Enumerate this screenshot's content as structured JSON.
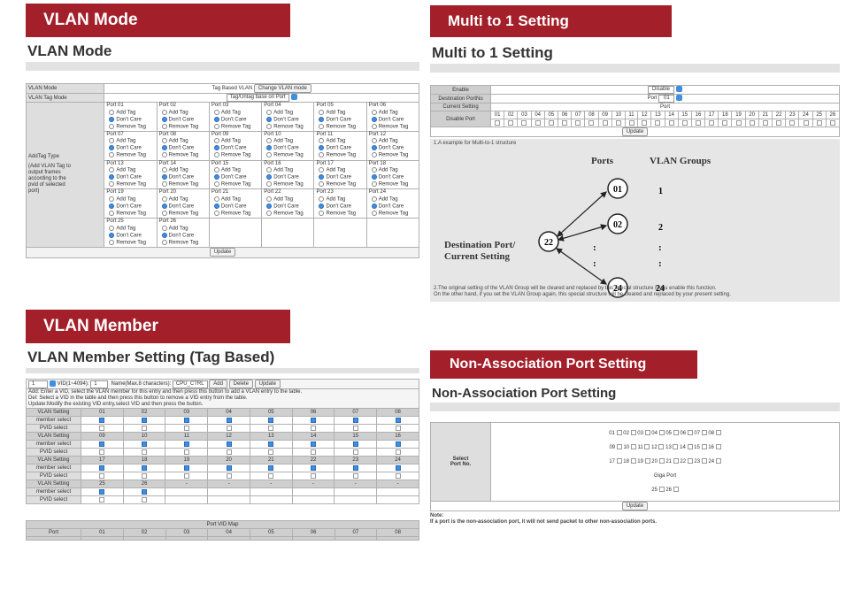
{
  "ribbons": {
    "vlan_mode": "VLAN Mode",
    "multi_to_1": "Multi to 1 Setting",
    "vlan_member": "VLAN Member",
    "non_assoc": "Non-Association Port Setting"
  },
  "vlan_mode": {
    "title": "VLAN Mode",
    "mode_label": "VLAN Mode",
    "mode_value": "Tag Based VLAN",
    "change_button": "Change VLAN mode",
    "tag_mode_label": "VLAN Tag Mode",
    "tag_mode_value": "Tag/Untag base on Port",
    "add_tag_type_label": "AddTag Type",
    "add_tag_type_help": "(Add VLAN Tag to output frames according to the pvid of selected port)",
    "option_add": "Add Tag",
    "option_dont": "Don't Care",
    "option_remove": "Remove Tag",
    "ports": [
      "Port 01",
      "Port 02",
      "Port 03",
      "Port 04",
      "Port 05",
      "Port 06",
      "Port 07",
      "Port 08",
      "Port 09",
      "Port 10",
      "Port 11",
      "Port 12",
      "Port 13",
      "Port 14",
      "Port 15",
      "Port 16",
      "Port 17",
      "Port 18",
      "Port 19",
      "Port 20",
      "Port 21",
      "Port 22",
      "Port 23",
      "Port 24",
      "Port 25",
      "Port 26"
    ],
    "update_button": "Update"
  },
  "multi": {
    "title": "Multi to 1 Setting",
    "enable_label": "Enable",
    "enable_value": "Disable",
    "dest_label": "Destination PortNo",
    "dest_prefix": "Port",
    "dest_value": "01",
    "current_label": "Current Setting",
    "disable_label": "Disable Port",
    "port_header": "Port",
    "ports": [
      "01",
      "02",
      "03",
      "04",
      "05",
      "06",
      "07",
      "08",
      "09",
      "10",
      "11",
      "12",
      "13",
      "14",
      "15",
      "16",
      "17",
      "18",
      "19",
      "20",
      "21",
      "22",
      "23",
      "24",
      "25",
      "26"
    ],
    "update_button": "Update",
    "note1": "1.A example for Multi-to-1 structure",
    "diagram": {
      "ports_head": "Ports",
      "groups_head": "VLAN Groups",
      "dest_line1": "Destination Port/",
      "dest_line2": "Current Setting",
      "dest_node": "22",
      "nodes": [
        "01",
        "02",
        "24"
      ],
      "groups": [
        "1",
        "2",
        "24"
      ],
      "dots": ":"
    },
    "note2": "2.The original setting of the VLAN Group will be cleared and replaced by this special structure if you enable this function.",
    "note3": "On the other hand, if you set the VLAN Group again, this special structure will be cleared and replaced by your present setting."
  },
  "member": {
    "title": "VLAN Member Setting (Tag Based)",
    "vid_value": "1",
    "vid_label": "VID(1~4094):",
    "vid_input": "1",
    "name_label": "Name(Max.8 characters):",
    "name_value": "CPU_CTRL",
    "add_button": "Add",
    "delete_button": "Delete",
    "update_button": "Update",
    "help1": "Add: Enter a VID, select the VLAN member for this entry and then press this button to add a VLAN entry to the table.",
    "help2": "Del: Select a VID in the table and then press this button to remove a VID entry from the table.",
    "help3": "Update:Modify the existing VID entry,select VID and then press the button.",
    "row_setting": "VLAN Setting",
    "row_member": "member select",
    "row_pvid": "PVID select",
    "groups": [
      [
        "01",
        "02",
        "03",
        "04",
        "05",
        "06",
        "07",
        "08"
      ],
      [
        "09",
        "10",
        "11",
        "12",
        "13",
        "14",
        "15",
        "16"
      ],
      [
        "17",
        "18",
        "19",
        "20",
        "21",
        "22",
        "23",
        "24"
      ],
      [
        "25",
        "26",
        "-",
        "-",
        "-",
        "-",
        "-",
        "-"
      ]
    ],
    "pvid_map_title": "Port VID Map",
    "pvid_port_label": "Port",
    "pvid_ports": [
      "01",
      "02",
      "03",
      "04",
      "05",
      "06",
      "07",
      "08"
    ]
  },
  "nonassoc": {
    "title": "Non-Association Port Setting",
    "select_label1": "Select",
    "select_label2": "Port No.",
    "rows": [
      [
        "01",
        "02",
        "03",
        "04",
        "05",
        "06",
        "07",
        "08"
      ],
      [
        "09",
        "10",
        "11",
        "12",
        "13",
        "14",
        "15",
        "16"
      ],
      [
        "17",
        "18",
        "19",
        "20",
        "21",
        "22",
        "23",
        "24"
      ]
    ],
    "giga_label": "Giga Port",
    "giga_ports": [
      "25",
      "26"
    ],
    "update_button": "Update",
    "note_title": "Note:",
    "note_text": "If a port is the non-association port, it will not send packet to other non-association ports."
  }
}
